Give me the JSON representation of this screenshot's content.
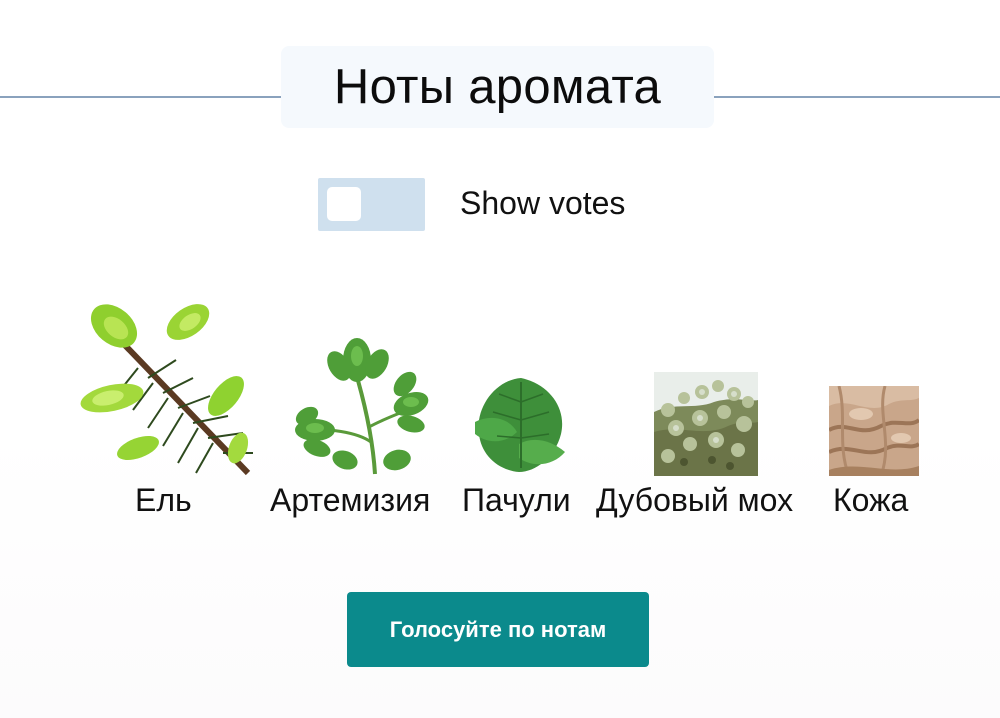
{
  "section": {
    "title": "Ноты аромата"
  },
  "toggle": {
    "label": "Show votes",
    "on": false
  },
  "notes": [
    {
      "label": "Ель",
      "icon": "spruce-branch-icon"
    },
    {
      "label": "Артемизия",
      "icon": "artemisia-leaf-icon"
    },
    {
      "label": "Пачули",
      "icon": "patchouli-leaf-icon"
    },
    {
      "label": "Дубовый мох",
      "icon": "oak-moss-icon"
    },
    {
      "label": "Кожа",
      "icon": "leather-icon"
    }
  ],
  "vote_button": {
    "label": "Голосуйте по нотам"
  },
  "colors": {
    "accent": "#0b8a8c",
    "divider": "#8aa2bd",
    "toggle_track": "#cfe0ee"
  }
}
